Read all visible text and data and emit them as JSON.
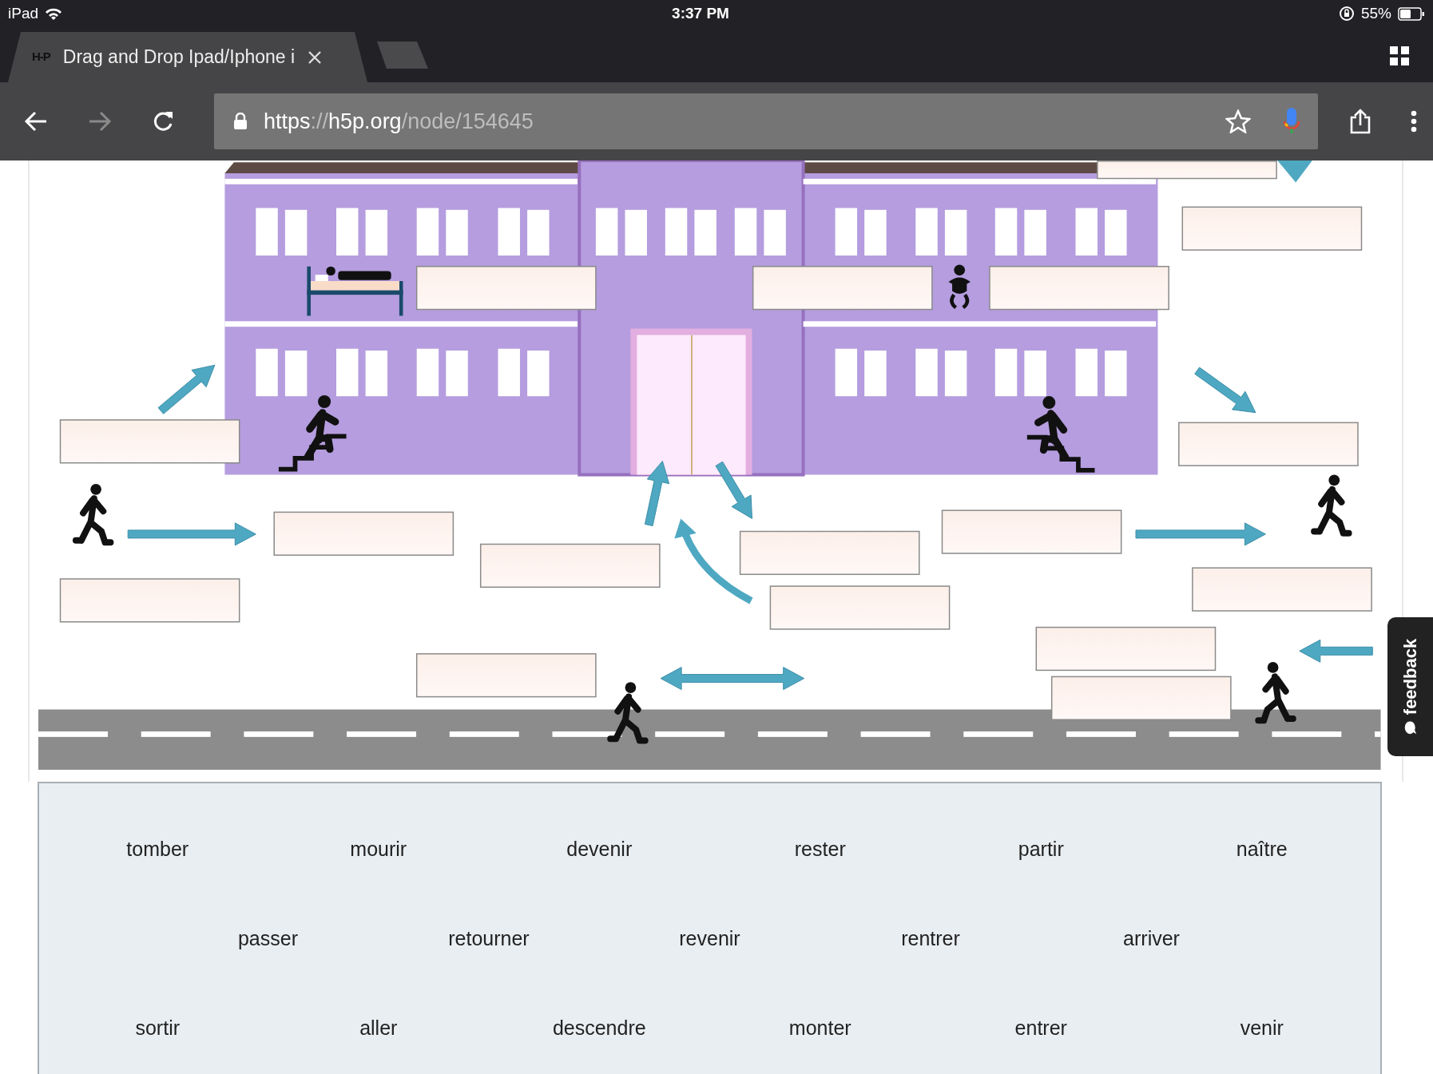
{
  "status_bar": {
    "device": "iPad",
    "time": "3:37 PM",
    "battery": "55%"
  },
  "tabs": [
    {
      "favicon": "H-P",
      "title": "Drag and Drop Ipad/Iphone i",
      "selected": true
    },
    {
      "selected": false
    }
  ],
  "toolbar": {
    "forward_disabled": true,
    "address_parts": [
      {
        "text": "https",
        "muted": false
      },
      {
        "text": "://",
        "muted": true
      },
      {
        "text": "h5p.org",
        "muted": false
      },
      {
        "text": "/node/154645",
        "muted": true
      }
    ]
  },
  "word_bank": {
    "rows": [
      [
        "tomber",
        "mourir",
        "devenir",
        "rester",
        "partir",
        "naître"
      ],
      [
        "passer",
        "retourner",
        "revenir",
        "rentrer",
        "arriver"
      ],
      [
        "sortir",
        "aller",
        "descendre",
        "monter",
        "entrer",
        "venir"
      ]
    ]
  },
  "feedback_tab": {
    "label": "feedback"
  }
}
